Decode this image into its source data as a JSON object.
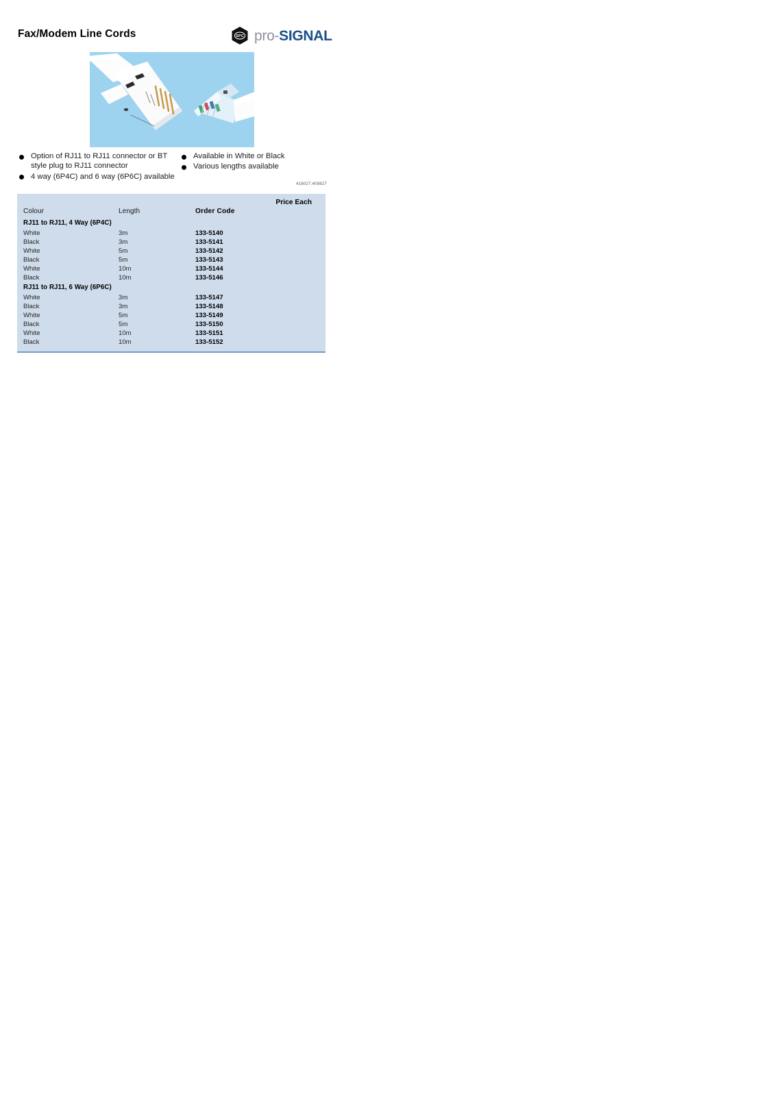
{
  "header": {
    "title": "Fax/Modem Line Cords",
    "brand": {
      "hex_text": "SPC",
      "name_prefix": "pro-",
      "name_suffix": "SIGNAL",
      "prefix_color": "#8d9199",
      "suffix_color": "#1a4f8a"
    }
  },
  "product_image": {
    "alt": "White BT style plug and RJ11 modular connector on light blue background",
    "background_color": "#9ed3f0"
  },
  "features": {
    "left": [
      "Option of RJ11 to RJ11 connector or BT style plug to RJ11 connector",
      "4 way (6P4C) and 6 way (6P6C) available"
    ],
    "right": [
      "Available in White or Black",
      "Various lengths available"
    ]
  },
  "reference_code": "416027.409827",
  "price_table": {
    "price_each_label": "Price Each",
    "columns": {
      "colour": "Colour",
      "length": "Length",
      "order_code": "Order Code"
    },
    "background_color": "#cfdcec",
    "rule_color": "#6e9cc6",
    "groups": [
      {
        "label": "RJ11 to RJ11, 4 Way (6P4C)",
        "rows": [
          {
            "colour": "White",
            "length": "3m",
            "order_code": "133-5140"
          },
          {
            "colour": "Black",
            "length": "3m",
            "order_code": "133-5141"
          },
          {
            "colour": "White",
            "length": "5m",
            "order_code": "133-5142"
          },
          {
            "colour": "Black",
            "length": "5m",
            "order_code": "133-5143"
          },
          {
            "colour": "White",
            "length": "10m",
            "order_code": "133-5144"
          },
          {
            "colour": "Black",
            "length": "10m",
            "order_code": "133-5146"
          }
        ]
      },
      {
        "label": "RJ11 to RJ11, 6 Way (6P6C)",
        "rows": [
          {
            "colour": "White",
            "length": "3m",
            "order_code": "133-5147"
          },
          {
            "colour": "Black",
            "length": "3m",
            "order_code": "133-5148"
          },
          {
            "colour": "White",
            "length": "5m",
            "order_code": "133-5149"
          },
          {
            "colour": "Black",
            "length": "5m",
            "order_code": "133-5150"
          },
          {
            "colour": "White",
            "length": "10m",
            "order_code": "133-5151"
          },
          {
            "colour": "Black",
            "length": "10m",
            "order_code": "133-5152"
          }
        ]
      }
    ]
  }
}
